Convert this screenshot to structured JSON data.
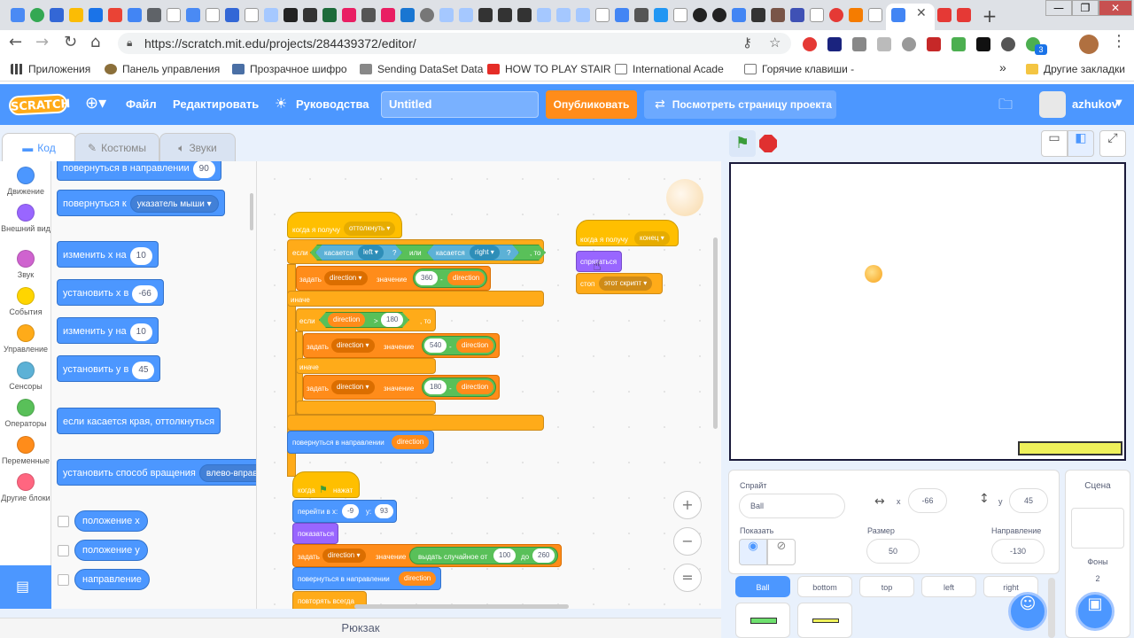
{
  "browser": {
    "url": "https://scratch.mit.edu/projects/284439372/editor/",
    "bookmarks": [
      "Приложения",
      "Панель управления",
      "Прозрачное шифро",
      "Sending DataSet Data",
      "HOW TO PLAY STAIR",
      "International Acade",
      "Горячие клавиши - ",
      "Другие закладки"
    ],
    "new_tab": "+",
    "badge_count": "3"
  },
  "menubar": {
    "logo": "SCRATCH",
    "file": "Файл",
    "edit": "Редактировать",
    "tutorials": "Руководства",
    "project_title": "Untitled",
    "share": "Опубликовать",
    "see_project": "Посмотреть страницу проекта",
    "username": "azhukov"
  },
  "tabs": {
    "code": "Код",
    "costumes": "Костюмы",
    "sounds": "Звуки"
  },
  "categories": [
    {
      "label": "Движение",
      "color": "#4c97ff"
    },
    {
      "label": "Внешний вид",
      "color": "#9966ff"
    },
    {
      "label": "Звук",
      "color": "#cf63cf"
    },
    {
      "label": "События",
      "color": "#ffd500"
    },
    {
      "label": "Управление",
      "color": "#ffab19"
    },
    {
      "label": "Сенсоры",
      "color": "#5cb1d6"
    },
    {
      "label": "Операторы",
      "color": "#59c059"
    },
    {
      "label": "Переменные",
      "color": "#ff8c1a"
    },
    {
      "label": "Другие блоки",
      "color": "#ff6680"
    }
  ],
  "palette": {
    "point_dir": "повернуться в направлении",
    "point_dir_val": "90",
    "point_towards": "повернуться к",
    "point_towards_val": "указатель мыши",
    "change_x": "изменить х на",
    "change_x_val": "10",
    "set_x": "установить х в",
    "set_x_val": "-66",
    "change_y": "изменить у на",
    "change_y_val": "10",
    "set_y": "установить у в",
    "set_y_val": "45",
    "bounce": "если касается края, оттолкнуться",
    "rotation_style": "установить способ вращения",
    "rotation_style_val": "влево-вправо",
    "rep_x": "положение х",
    "rep_y": "положение у",
    "rep_dir": "направление"
  },
  "script1": {
    "hat": "когда я получу",
    "hat_msg": "оттолкнуть",
    "if": "если",
    "touching": "касается",
    "left": "left",
    "q": "?",
    "or": "или",
    "right": "right",
    "then": ", то",
    "set": "задать",
    "var": "direction",
    "to": "значение",
    "v360": "360",
    "minus": "-",
    "else": "иначе",
    "v180": "180",
    "gt": ">",
    "v540": "540",
    "point": "повернуться в направлении"
  },
  "script2": {
    "hat": "когда я получу",
    "msg": "конец",
    "hide": "спрятаться",
    "stop": "стоп",
    "stop_val": "этот скрипт"
  },
  "script3": {
    "hat": "когда",
    "hat2": "нажат",
    "goto": "перейти в x:",
    "goto_x": "-9",
    "goto_y_lbl": "y:",
    "goto_y": "93",
    "show": "показаться",
    "set": "задать",
    "var": "direction",
    "to": "значение",
    "random": "выдать случайное от",
    "r_from": "100",
    "r_to_lbl": "до",
    "r_to": "260",
    "point": "повернуться в направлении",
    "forever": "повторять всегда"
  },
  "zoom": {
    "in": "+",
    "out": "−",
    "reset": "="
  },
  "backpack": "Рюкзак",
  "sprite_panel": {
    "sprite_label": "Спрайт",
    "sprite_name": "Ball",
    "x_label": "x",
    "x": "-66",
    "y_label": "у",
    "y": "45",
    "show_label": "Показать",
    "size_label": "Размер",
    "size": "50",
    "direction_label": "Направление",
    "direction": "-130",
    "sprites": [
      "Ball",
      "bottom",
      "top",
      "left",
      "right"
    ]
  },
  "scene_panel": {
    "title": "Сцена",
    "backdrops_label": "Фоны",
    "backdrops_count": "2"
  },
  "colors": {
    "accent": "#4c97ff",
    "events": "#ffbf00",
    "control": "#ffab19",
    "variables": "#ff8c1a",
    "operators": "#59c059",
    "sensing": "#5cb1d6",
    "looks": "#9966ff"
  }
}
